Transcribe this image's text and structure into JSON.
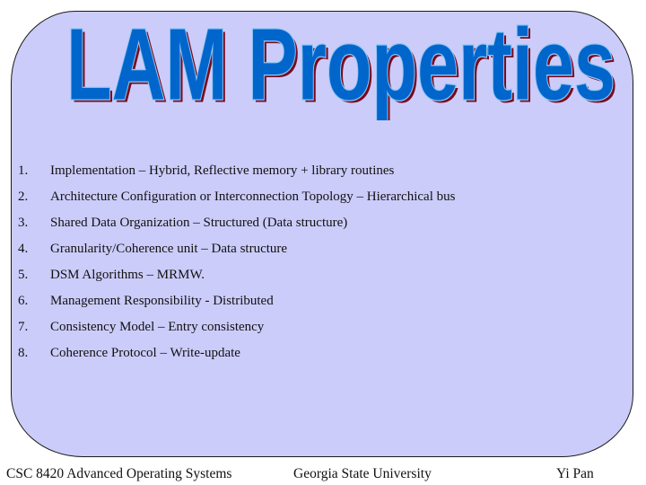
{
  "slide": {
    "title": "LAM Properties",
    "colors": {
      "panel_fill": "#ccccfb",
      "title_fill": "#0066cc",
      "title_outline": "#8fc8f5",
      "title_shadow": "#7a0a1e"
    },
    "items": [
      {
        "number": "1.",
        "text": "Implementation – Hybrid, Reflective memory + library routines"
      },
      {
        "number": "2.",
        "text": "Architecture Configuration or Interconnection Topology – Hierarchical bus"
      },
      {
        "number": "3.",
        "text": "Shared Data Organization – Structured (Data structure)"
      },
      {
        "number": "4.",
        "text": "Granularity/Coherence unit – Data structure"
      },
      {
        "number": "5.",
        "text": "DSM Algorithms – MRMW."
      },
      {
        "number": "6.",
        "text": "Management Responsibility - Distributed"
      },
      {
        "number": "7.",
        "text": "Consistency Model – Entry consistency"
      },
      {
        "number": "8.",
        "text": "Coherence Protocol – Write-update"
      }
    ],
    "footer": {
      "course": "CSC 8420 Advanced Operating Systems",
      "university": "Georgia State University",
      "author": "Yi Pan"
    }
  }
}
